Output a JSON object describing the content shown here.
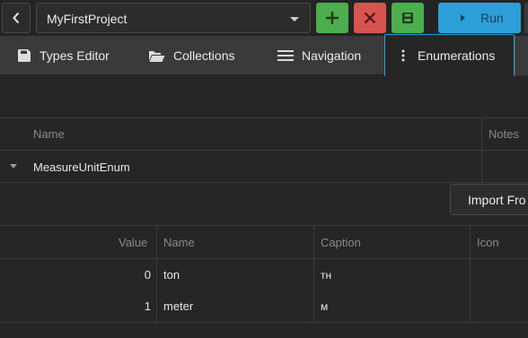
{
  "toolbar": {
    "project": "MyFirstProject",
    "run_label": "Run",
    "colors": {
      "add": "#4cae4c",
      "delete": "#d9534f",
      "save": "#4cae4c",
      "run": "#2c9fd9"
    }
  },
  "tabs": [
    {
      "label": "Types Editor",
      "icon": "save-disk-icon"
    },
    {
      "label": "Collections",
      "icon": "folder-open-icon"
    },
    {
      "label": "Navigation",
      "icon": "hamburger-menu-icon"
    },
    {
      "label": "Enumerations",
      "icon": "vertical-dots-icon",
      "active": true
    }
  ],
  "enum_table": {
    "headers": {
      "name": "Name",
      "notes": "Notes"
    },
    "rows": [
      {
        "name": "MeasureUnitEnum",
        "notes": ""
      }
    ]
  },
  "import_button": "Import Fro",
  "values_table": {
    "headers": {
      "value": "Value",
      "name": "Name",
      "caption": "Caption",
      "icon": "Icon"
    },
    "rows": [
      {
        "value": "0",
        "name": "ton",
        "caption": "тн",
        "icon": ""
      },
      {
        "value": "1",
        "name": "meter",
        "caption": "м",
        "icon": ""
      }
    ]
  }
}
